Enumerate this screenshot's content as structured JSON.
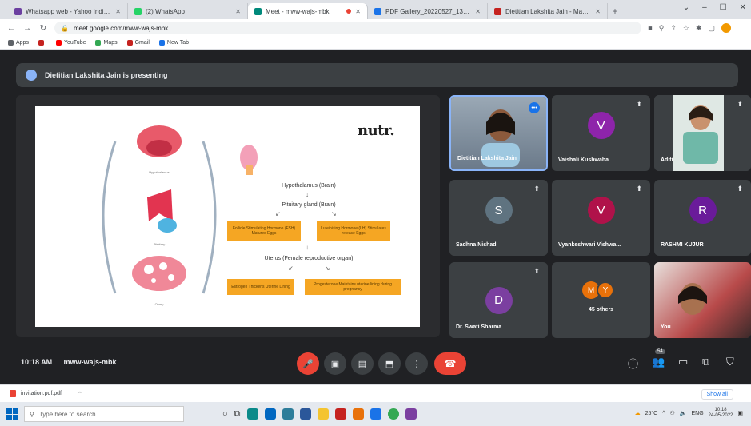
{
  "browser": {
    "tabs": [
      {
        "title": "Whatsapp web - Yahoo India Se...",
        "color": "#6b3fa0",
        "active": false
      },
      {
        "title": "(2) WhatsApp",
        "color": "#25d366",
        "active": false
      },
      {
        "title": "Meet - mww-wajs-mbk",
        "color": "#00897b",
        "active": true
      },
      {
        "title": "PDF Gallery_20220527_134511...",
        "color": "#1a73e8",
        "active": false
      },
      {
        "title": "Dietitian Lakshita Jain - Mangal...",
        "color": "#c5221f",
        "active": false
      }
    ],
    "new_tab": "+",
    "window_controls": [
      "⌄",
      "–",
      "☐",
      "✕"
    ],
    "nav": {
      "back": "←",
      "forward": "→",
      "reload": "↻"
    },
    "url": "meet.google.com/mww-wajs-mbk",
    "bookmarks": [
      {
        "label": "Apps",
        "color": "#5f6368"
      },
      {
        "label": "",
        "color": "#c5221f"
      },
      {
        "label": "YouTube",
        "color": "#ff0000"
      },
      {
        "label": "Maps",
        "color": "#34a853"
      },
      {
        "label": "Gmail",
        "color": "#c5221f"
      },
      {
        "label": "New Tab",
        "color": "#1a73e8"
      }
    ]
  },
  "meet": {
    "presenting_text": "Dietitian Lakshita Jain is presenting",
    "slide": {
      "brand": "nutr.",
      "flow": {
        "step1": "Hypothalamus (Brain)",
        "step2": "Pituitary gland (Brain)",
        "box_a": "Follicle Stimulating Hormone (FSH) Matures Eggs",
        "box_b": "Luteinizing Hormone (LH) Stimulates release Eggs",
        "step3": "Uterus (Female reproductive organ)",
        "box_c": "Estrogen Thickens Uterine Lining",
        "box_d": "Progesterone Maintains uterine lining during pregnancy"
      },
      "diagram_labels": {
        "hypothalamus": "Hypothalamus",
        "pituitary": "Pituitary",
        "ovary": "Ovary"
      }
    },
    "participants": [
      {
        "name": "Dietitian Lakshita Jain",
        "type": "video",
        "bg": "#6b7a8a"
      },
      {
        "name": "Vaishali Kushwaha",
        "type": "avatar",
        "initial": "V",
        "color": "#8e24aa"
      },
      {
        "name": "Aditi",
        "type": "video",
        "bg": "#4a5a5c"
      },
      {
        "name": "Sadhna Nishad",
        "type": "avatar",
        "initial": "S",
        "color": "#5f7380"
      },
      {
        "name": "Vyankeshwari Vishwa...",
        "type": "avatar",
        "initial": "V",
        "color": "#b0124a"
      },
      {
        "name": "RASHMI KUJUR",
        "type": "avatar",
        "initial": "R",
        "color": "#6a1b9a"
      },
      {
        "name": "Dr. Swati Sharma",
        "type": "avatar",
        "initial": "D",
        "color": "#7b3fa0"
      },
      {
        "name": "45 others",
        "type": "group",
        "initials": [
          "M",
          "Y"
        ],
        "colors": [
          "#e8710a",
          "#e8710a"
        ]
      },
      {
        "name": "You",
        "type": "video",
        "bg": "#8a3a3a"
      }
    ],
    "meeting_time": "10:18 AM",
    "meeting_code": "mww-wajs-mbk",
    "participant_count": "54"
  },
  "downloads": {
    "file": "invitation.pdf.pdf",
    "show_all": "Show all"
  },
  "taskbar": {
    "search_placeholder": "Type here to search",
    "weather": "25°C",
    "lang": "ENG",
    "time": "10:18",
    "date": "24-05-2022"
  }
}
